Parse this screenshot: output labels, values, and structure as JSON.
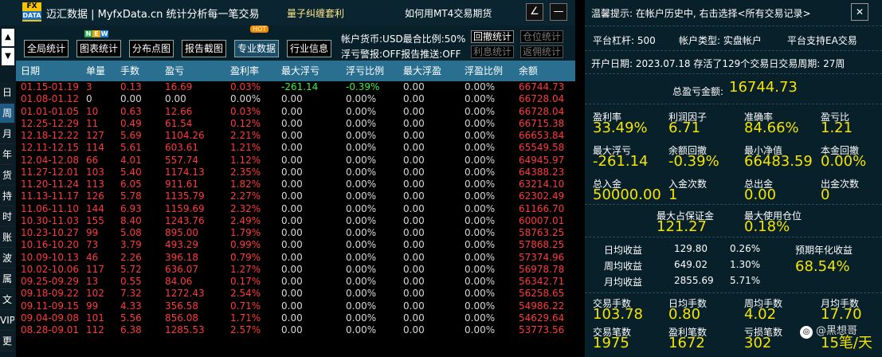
{
  "window": {
    "logo_top": "FX",
    "logo_bottom": "DATA",
    "title": "迈汇数据 | MyfxData.cn  统计分析每一笔交易",
    "promo_1": "量子纠缠套利",
    "promo_2": "如何用MT4交易期货",
    "pin_glyph": "∠",
    "min_glyph": "—"
  },
  "left_nav": {
    "up": "▲",
    "down": "▼",
    "tabs": [
      {
        "label": "日"
      },
      {
        "label": "周",
        "active": true
      },
      {
        "label": "月"
      },
      {
        "label": "年"
      },
      {
        "label": "货币"
      },
      {
        "label": "持仓"
      },
      {
        "label": "时间"
      },
      {
        "label": "账号"
      },
      {
        "label": "波幅"
      },
      {
        "label": "属性"
      },
      {
        "label": "文字"
      },
      {
        "label": "VIP"
      },
      {
        "label": "更多"
      }
    ]
  },
  "toolbar": {
    "buttons": [
      {
        "label": "全局统计"
      },
      {
        "label": "图表统计"
      },
      {
        "label": "分布点图"
      },
      {
        "label": "报告截图"
      },
      {
        "label": "专业数据",
        "active": true
      },
      {
        "label": "行业信息"
      }
    ],
    "new_badge": [
      "N",
      "E",
      "W"
    ],
    "hot_badge": "HOT",
    "account_line": "帐户货币:USD最合比例:50%",
    "alert_line": "浮亏警报:OFF报告推送:OFF",
    "small_buttons": [
      {
        "label": "回撤统计",
        "dim": false
      },
      {
        "label": "仓位统计",
        "dim": true
      },
      {
        "label": "利息统计",
        "dim": true
      },
      {
        "label": "返佣统计",
        "dim": true
      }
    ]
  },
  "table": {
    "columns": [
      "日期",
      "单量",
      "手数",
      "盈亏",
      "盈利率",
      "最大浮亏",
      "浮亏比例",
      "最大浮盈",
      "浮盈比例",
      "余额"
    ],
    "rows": [
      [
        "01.15-01.19",
        "3",
        "0.13",
        "16.69",
        "0.03%",
        "-261.14",
        "-0.39%",
        "0.00",
        "0.00%",
        "66744.73"
      ],
      [
        "01.08-01.12",
        "0",
        "0.00",
        "0.00",
        "0.00%",
        "0.00",
        "0.00%",
        "0.00",
        "0.00%",
        "66728.04"
      ],
      [
        "01.01-01.05",
        "10",
        "0.63",
        "12.66",
        "0.03%",
        "0.00",
        "0.00%",
        "0.00",
        "0.00%",
        "66728.04"
      ],
      [
        "12.25-12.29",
        "11",
        "0.49",
        "61.54",
        "0.12%",
        "0.00",
        "0.00%",
        "0.00",
        "0.00%",
        "66715.38"
      ],
      [
        "12.18-12.22",
        "127",
        "5.69",
        "1104.26",
        "2.21%",
        "0.00",
        "0.00%",
        "0.00",
        "0.00%",
        "66653.84"
      ],
      [
        "12.11-12.15",
        "114",
        "5.61",
        "603.61",
        "1.21%",
        "0.00",
        "0.00%",
        "0.00",
        "0.00%",
        "65549.58"
      ],
      [
        "12.04-12.08",
        "66",
        "4.01",
        "557.74",
        "1.12%",
        "0.00",
        "0.00%",
        "0.00",
        "0.00%",
        "64945.97"
      ],
      [
        "11.27-12.01",
        "103",
        "5.40",
        "1174.13",
        "2.35%",
        "0.00",
        "0.00%",
        "0.00",
        "0.00%",
        "64388.23"
      ],
      [
        "11.20-11.24",
        "113",
        "6.05",
        "911.61",
        "1.82%",
        "0.00",
        "0.00%",
        "0.00",
        "0.00%",
        "63214.10"
      ],
      [
        "11.13-11.17",
        "126",
        "5.78",
        "1135.79",
        "2.27%",
        "0.00",
        "0.00%",
        "0.00",
        "0.00%",
        "62302.49"
      ],
      [
        "11.06-11.10",
        "144",
        "6.93",
        "1159.69",
        "2.32%",
        "0.00",
        "0.00%",
        "0.00",
        "0.00%",
        "61166.70"
      ],
      [
        "10.30-11.03",
        "155",
        "8.40",
        "1243.76",
        "2.49%",
        "0.00",
        "0.00%",
        "0.00",
        "0.00%",
        "60007.01"
      ],
      [
        "10.23-10.27",
        "99",
        "5.08",
        "895.00",
        "1.79%",
        "0.00",
        "0.00%",
        "0.00",
        "0.00%",
        "58763.25"
      ],
      [
        "10.16-10.20",
        "73",
        "3.79",
        "493.29",
        "0.99%",
        "0.00",
        "0.00%",
        "0.00",
        "0.00%",
        "57868.25"
      ],
      [
        "10.09-10.13",
        "46",
        "2.26",
        "396.18",
        "0.79%",
        "0.00",
        "0.00%",
        "0.00",
        "0.00%",
        "57374.96"
      ],
      [
        "10.02-10.06",
        "117",
        "5.72",
        "636.07",
        "1.27%",
        "0.00",
        "0.00%",
        "0.00",
        "0.00%",
        "56978.78"
      ],
      [
        "09.25-09.29",
        "13",
        "0.55",
        "84.06",
        "0.17%",
        "0.00",
        "0.00%",
        "0.00",
        "0.00%",
        "56342.71"
      ],
      [
        "09.18-09.22",
        "102",
        "7.32",
        "1272.43",
        "2.54%",
        "0.00",
        "0.00%",
        "0.00",
        "0.00%",
        "56258.65"
      ],
      [
        "09.11-09.15",
        "99",
        "4.33",
        "356.58",
        "0.71%",
        "0.00",
        "0.00%",
        "0.00",
        "0.00%",
        "54986.22"
      ],
      [
        "09.04-09.08",
        "101",
        "5.56",
        "856.08",
        "1.71%",
        "0.00",
        "0.00%",
        "0.00",
        "0.00%",
        "54629.64"
      ],
      [
        "08.28-09.01",
        "112",
        "6.38",
        "1285.53",
        "2.57%",
        "0.00",
        "0.00%",
        "0.00",
        "0.00%",
        "53773.56"
      ]
    ]
  },
  "panel": {
    "tip": "温馨提示: 在帐户历史中, 右击选择<所有交易记录>",
    "close_glyph": "✕",
    "leverage": "平台杠杆: 500",
    "account_type": "帐户类型: 实盘帐户",
    "ea_support": "平台支持EA交易",
    "open_info": "开户日期: 2023.07.18 存活了129个交易日交易周期: 27周",
    "total_label": "总盈亏金额:",
    "total_value": "16744.73",
    "stats": [
      {
        "label": "盈利率",
        "value": "33.49%"
      },
      {
        "label": "利润因子",
        "value": "6.71"
      },
      {
        "label": "准确率",
        "value": "84.66%"
      },
      {
        "label": "盈亏比",
        "value": "1.21"
      },
      {
        "label": "最大浮亏",
        "value": "-261.14"
      },
      {
        "label": "余额回撤",
        "value": "-0.39%"
      },
      {
        "label": "最小净值",
        "value": "66483.59"
      },
      {
        "label": "本金回撤",
        "value": "0.00%"
      },
      {
        "label": "总入金",
        "value": "50000.00"
      },
      {
        "label": "入金次数",
        "value": "1"
      },
      {
        "label": "总出金",
        "value": "0.00"
      },
      {
        "label": "出金次数",
        "value": "0"
      }
    ],
    "margin": {
      "label": "最大占保证金",
      "value": "121.27"
    },
    "max_pos": {
      "label": "最大使用仓位",
      "value": "0.18%"
    },
    "earnings": [
      {
        "label": "日均收益",
        "amount": "129.80",
        "pct": "0.26%"
      },
      {
        "label": "周均收益",
        "amount": "649.02",
        "pct": "1.30%"
      },
      {
        "label": "月均收益",
        "amount": "2855.69",
        "pct": "5.71%"
      }
    ],
    "annual": {
      "label": "预期年化收益",
      "value": "68.54%"
    },
    "bottom": [
      {
        "label": "交易手数",
        "value": "103.78"
      },
      {
        "label": "日均手数",
        "value": "0.80"
      },
      {
        "label": "周均手数",
        "value": "4.02"
      },
      {
        "label": "月均手数",
        "value": "17.70"
      },
      {
        "label": "交易笔数",
        "value": "1975"
      },
      {
        "label": "盈利笔数",
        "value": "1672"
      },
      {
        "label": "亏损笔数",
        "value": "302"
      },
      {
        "label": "",
        "value": "15笔/天"
      }
    ],
    "watermark_icon": "◎",
    "watermark": "@黑想哥"
  }
}
